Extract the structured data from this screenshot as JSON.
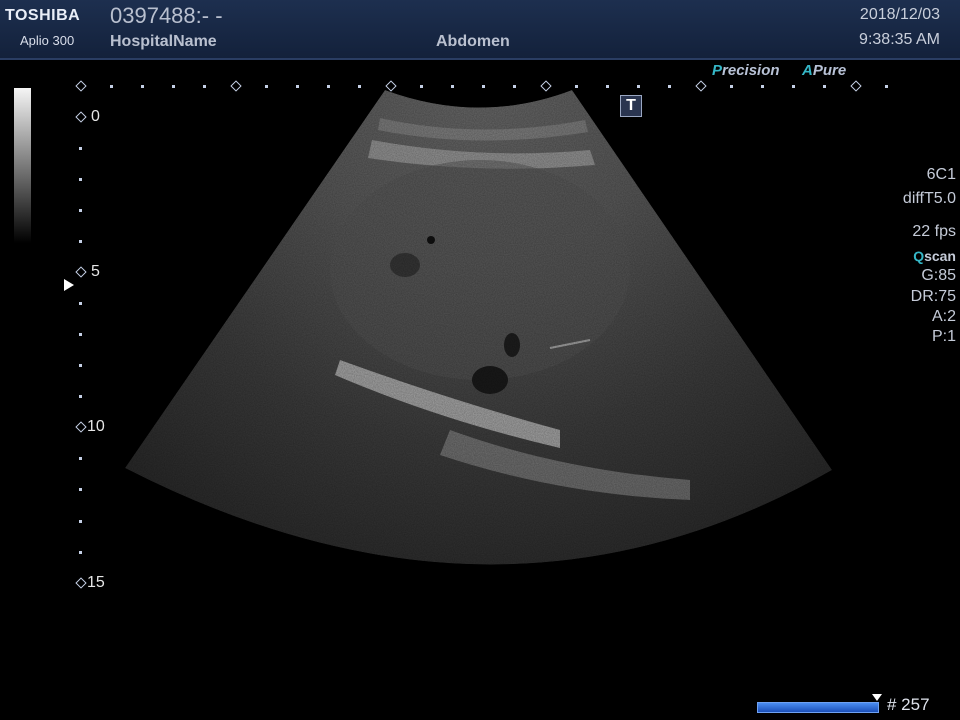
{
  "header": {
    "brand": "TOSHIBA",
    "model": "Aplio 300",
    "patient_id": "0397488:- -",
    "hospital": "HospitalName",
    "preset": "Abdomen",
    "date": "2018/12/03",
    "time": "9:38:35 AM"
  },
  "tech": {
    "precision_initial": "P",
    "precision_rest": "recision",
    "apure_initial": "A",
    "apure_rest": "Pure"
  },
  "t_icon": "T",
  "depth": {
    "labels": [
      "0",
      "5",
      "10",
      "15"
    ]
  },
  "params": {
    "probe": "6C1",
    "mode": "diffT5.0",
    "fps": "22 fps",
    "qscan_initial": "Q",
    "qscan_rest": "scan",
    "gain": "G:85",
    "dynamic_range": "DR:75",
    "a": "A:2",
    "p": "P:1"
  },
  "cine": {
    "frame": "# 257"
  },
  "colors": {
    "header_bg": "#1d2f4f",
    "accent_teal": "#35b7c7",
    "cine_blue": "#2f6fd8"
  }
}
